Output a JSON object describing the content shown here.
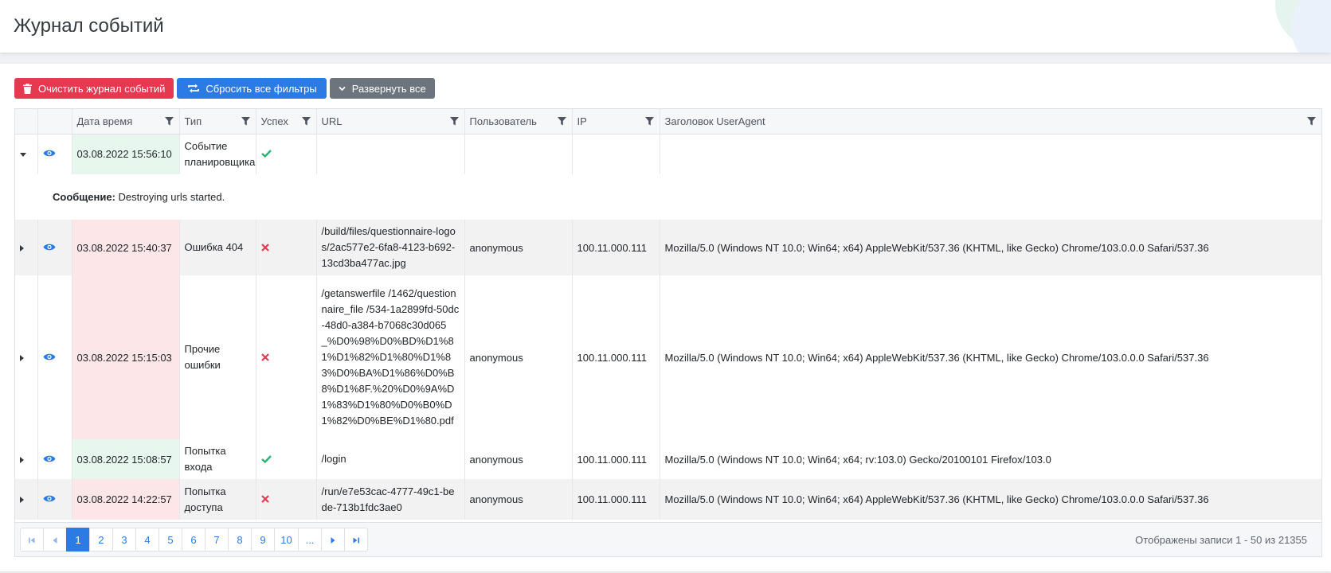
{
  "page": {
    "title": "Журнал событий"
  },
  "toolbar": {
    "clear_label": "Очистить журнал событий",
    "reset_label": "Сбросить все фильтры",
    "expand_label": "Развернуть все"
  },
  "colors": {
    "danger": "#e53950",
    "primary": "#2c7be5",
    "secondary": "#6c757d",
    "success_bg": "#e7f7ee",
    "error_bg": "#fce6e8",
    "success_icon": "#22b573",
    "error_icon": "#e53950"
  },
  "grid": {
    "columns": [
      "Дата время",
      "Тип",
      "Успех",
      "URL",
      "Пользователь",
      "IP",
      "Заголовок UserAgent"
    ],
    "rows": [
      {
        "date": "03.08.2022 15:56:10",
        "type": "Событие планировщика",
        "success": "check-icon",
        "url": "",
        "user": "",
        "ip": "",
        "ua": "",
        "expanded": true,
        "message_label": "Сообщение:",
        "message": "Destroying urls started."
      },
      {
        "date": "03.08.2022 15:40:37",
        "type": "Ошибка 404",
        "success": "cross-icon",
        "url": "/build/files/questionnaire-logos/2ac577e2-6fa8-4123-b692-13cd3ba477ac.jpg",
        "user": "anonymous",
        "ip": "100.11.000.111",
        "ua": "Mozilla/5.0 (Windows NT 10.0; Win64; x64) AppleWebKit/537.36 (KHTML, like Gecko) Chrome/103.0.0.0 Safari/537.36"
      },
      {
        "date": "03.08.2022 15:15:03",
        "type": "Прочие ошибки",
        "success": "cross-icon",
        "url": "/getanswerfile /1462/questionnaire_file /534-1a2899fd-50dc-48d0-a384-b7068c30d065_%D0%98%D0%BD%D1%81%D1%82%D1%80%D1%83%D0%BA%D1%86%D0%B8%D1%8F.%20%D0%9A%D1%83%D1%80%D0%B0%D1%82%D0%BE%D1%80.pdf",
        "user": "anonymous",
        "ip": "100.11.000.111",
        "ua": "Mozilla/5.0 (Windows NT 10.0; Win64; x64) AppleWebKit/537.36 (KHTML, like Gecko) Chrome/103.0.0.0 Safari/537.36"
      },
      {
        "date": "03.08.2022 15:08:57",
        "type": "Попытка входа",
        "success": "check-icon",
        "url": "/login",
        "user": "anonymous",
        "ip": "100.11.000.111",
        "ua": "Mozilla/5.0 (Windows NT 10.0; Win64; x64; rv:103.0) Gecko/20100101 Firefox/103.0"
      },
      {
        "date": "03.08.2022 14:22:57",
        "type": "Попытка доступа",
        "success": "cross-icon",
        "url": "/run/e7e53cac-4777-49c1-bede-713b1fdc3ae0",
        "user": "anonymous",
        "ip": "100.11.000.111",
        "ua": "Mozilla/5.0 (Windows NT 10.0; Win64; x64) AppleWebKit/537.36 (KHTML, like Gecko) Chrome/103.0.0.0 Safari/537.36"
      }
    ]
  },
  "pager": {
    "pages": [
      "1",
      "2",
      "3",
      "4",
      "5",
      "6",
      "7",
      "8",
      "9",
      "10",
      "..."
    ],
    "current": "1",
    "info": "Отображены записи 1 - 50 из 21355"
  }
}
